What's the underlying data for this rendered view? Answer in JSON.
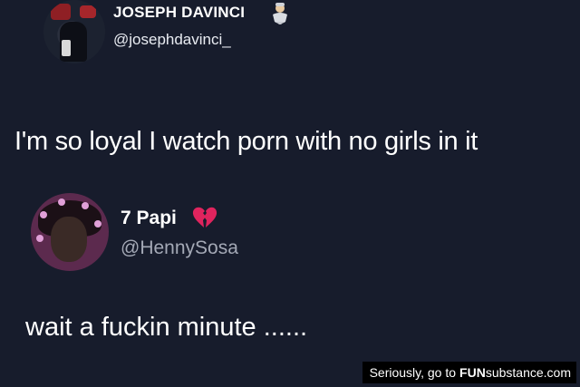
{
  "tweet1": {
    "display_name": "JOSEPH DAVINCI",
    "handle": "@josephdavinci_",
    "name_emoji": "genie-emoji",
    "text": "I'm so loyal I watch porn with no girls in it"
  },
  "tweet2": {
    "display_name": "7 Papi",
    "handle": "@HennySosa",
    "name_emoji": "broken-heart-emoji",
    "text": "wait a fuckin minute ......"
  },
  "watermark": {
    "prefix": "Seriously, go to",
    "brand_fun": "FUN",
    "brand_rest": "substance.com"
  },
  "colors": {
    "background": "#171c2c",
    "primary_text": "#ffffff",
    "secondary_text": "#a4a9b6",
    "broken_heart": "#e0245e"
  }
}
